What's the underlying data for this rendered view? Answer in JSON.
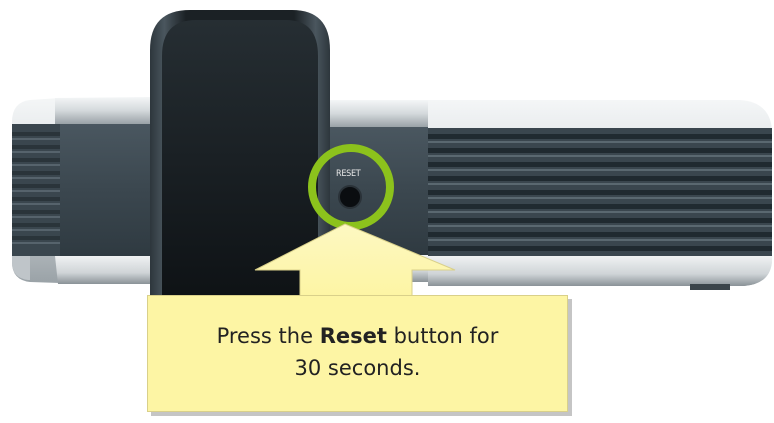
{
  "device": {
    "reset_label": "RESET"
  },
  "callout": {
    "text_before": "Press the ",
    "text_bold": "Reset",
    "text_after": " button for",
    "text_line2": "30 seconds."
  },
  "colors": {
    "highlight_ring": "#8cc21c",
    "callout_fill": "#fdf5a4",
    "body_dark": "#3e4a52",
    "body_silver": "#d8dcdf"
  }
}
